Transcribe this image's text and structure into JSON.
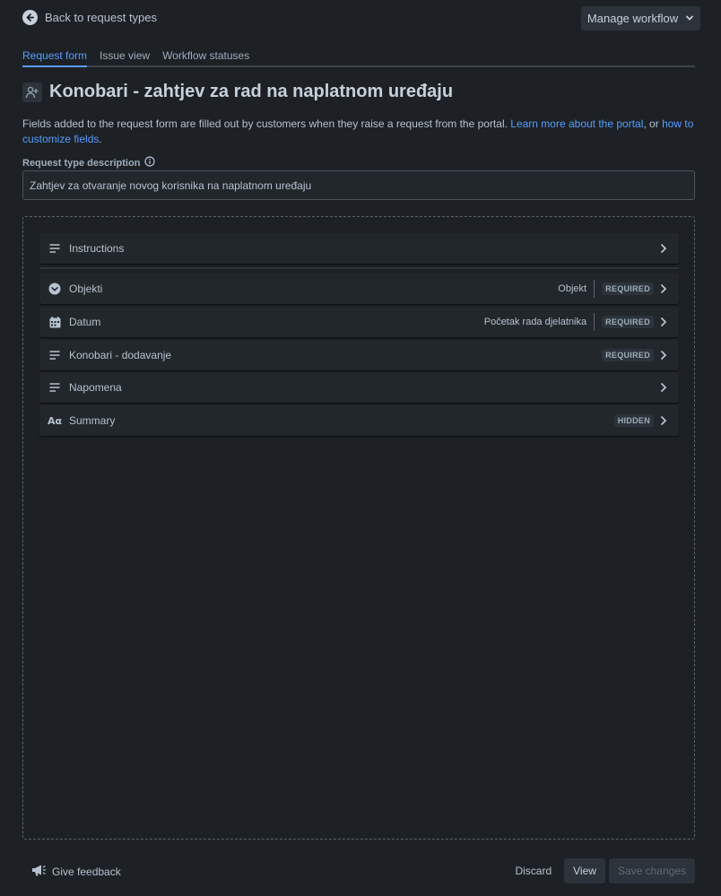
{
  "topbar": {
    "back_label": "Back to request types",
    "manage_label": "Manage workflow"
  },
  "tabs": [
    {
      "label": "Request form",
      "active": true
    },
    {
      "label": "Issue view",
      "active": false
    },
    {
      "label": "Workflow statuses",
      "active": false
    }
  ],
  "page": {
    "title": "Konobari - zahtjev za rad na naplatnom uređaju",
    "desc_text": "Fields added to the request form are filled out by customers when they raise a request from the portal. ",
    "desc_link1": "Learn more about the portal",
    "desc_mid": ", or ",
    "desc_link2": "how to customize fields",
    "desc_end": "."
  },
  "description_field": {
    "label": "Request type description",
    "value": "Zahtjev za otvaranje novog korisnika na naplatnom uređaju"
  },
  "fields": [
    {
      "label": "Instructions",
      "icon": "text-lines-icon",
      "field_name": "",
      "badge": ""
    },
    {
      "label": "Objekti",
      "icon": "chevron-circle-icon",
      "field_name": "Objekt",
      "badge": "REQUIRED"
    },
    {
      "label": "Datum",
      "icon": "calendar-icon",
      "field_name": "Početak rada djelatnika",
      "badge": "REQUIRED"
    },
    {
      "label": "Konobari - dodavanje",
      "icon": "text-lines-icon",
      "field_name": "",
      "badge": "REQUIRED"
    },
    {
      "label": "Napomena",
      "icon": "text-lines-icon",
      "field_name": "",
      "badge": ""
    },
    {
      "label": "Summary",
      "icon": "text-format-icon",
      "field_name": "",
      "badge": "HIDDEN"
    }
  ],
  "footer": {
    "feedback_label": "Give feedback",
    "discard_label": "Discard",
    "view_label": "View",
    "save_label": "Save changes"
  }
}
